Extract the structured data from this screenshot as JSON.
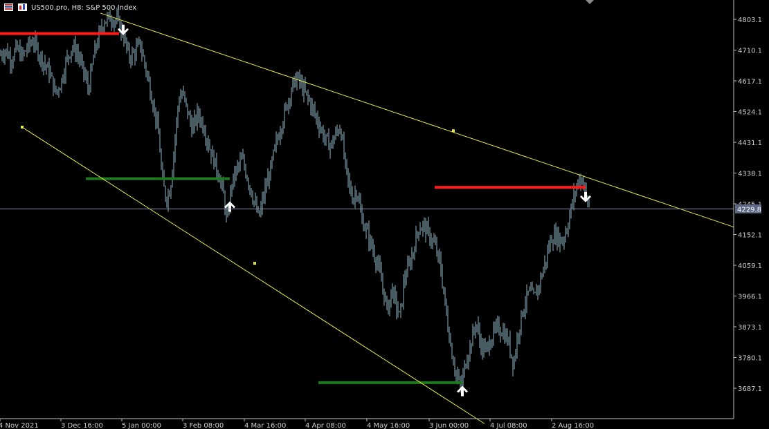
{
  "chart_data": {
    "type": "candlestick",
    "title": "US500.pro, H8:  S&P 500 Index",
    "symbol": "US500.pro",
    "timeframe": "H8",
    "description": "S&P 500 Index",
    "current_price": "4229.8",
    "y_ticks": [
      "4803.1",
      "4710.1",
      "4617.1",
      "4524.1",
      "4431.1",
      "4338.1",
      "4245.1",
      "4152.1",
      "4059.1",
      "3966.1",
      "3873.1",
      "3780.1",
      "3687.1"
    ],
    "x_ticks": [
      "4 Nov 2021",
      "3 Dec 16:00",
      "5 Jan 00:00",
      "3 Feb 08:00",
      "4 Mar 16:00",
      "4 Apr 08:00",
      "4 May 16:00",
      "3 Jun 00:00",
      "4 Jul 08:00",
      "2 Aug 16:00"
    ],
    "price_path": [
      [
        0,
        4695
      ],
      [
        8,
        4710
      ],
      [
        16,
        4680
      ],
      [
        24,
        4715
      ],
      [
        32,
        4690
      ],
      [
        40,
        4720
      ],
      [
        48,
        4740
      ],
      [
        56,
        4700
      ],
      [
        64,
        4670
      ],
      [
        72,
        4640
      ],
      [
        80,
        4580
      ],
      [
        88,
        4610
      ],
      [
        96,
        4680
      ],
      [
        104,
        4720
      ],
      [
        112,
        4700
      ],
      [
        120,
        4650
      ],
      [
        128,
        4590
      ],
      [
        136,
        4700
      ],
      [
        144,
        4760
      ],
      [
        150,
        4800
      ],
      [
        160,
        4808
      ],
      [
        170,
        4795
      ],
      [
        178,
        4760
      ],
      [
        186,
        4690
      ],
      [
        194,
        4700
      ],
      [
        202,
        4730
      ],
      [
        210,
        4660
      ],
      [
        218,
        4580
      ],
      [
        224,
        4520
      ],
      [
        230,
        4440
      ],
      [
        234,
        4320
      ],
      [
        240,
        4260
      ],
      [
        246,
        4290
      ],
      [
        252,
        4420
      ],
      [
        258,
        4560
      ],
      [
        264,
        4580
      ],
      [
        270,
        4530
      ],
      [
        278,
        4470
      ],
      [
        286,
        4520
      ],
      [
        294,
        4480
      ],
      [
        302,
        4420
      ],
      [
        310,
        4370
      ],
      [
        318,
        4320
      ],
      [
        324,
        4260
      ],
      [
        328,
        4180
      ],
      [
        334,
        4300
      ],
      [
        342,
        4350
      ],
      [
        350,
        4380
      ],
      [
        358,
        4320
      ],
      [
        366,
        4260
      ],
      [
        374,
        4200
      ],
      [
        382,
        4280
      ],
      [
        390,
        4340
      ],
      [
        398,
        4420
      ],
      [
        406,
        4480
      ],
      [
        414,
        4540
      ],
      [
        422,
        4600
      ],
      [
        430,
        4628
      ],
      [
        438,
        4590
      ],
      [
        446,
        4560
      ],
      [
        454,
        4520
      ],
      [
        462,
        4480
      ],
      [
        470,
        4440
      ],
      [
        478,
        4420
      ],
      [
        486,
        4460
      ],
      [
        492,
        4480
      ],
      [
        498,
        4370
      ],
      [
        504,
        4300
      ],
      [
        510,
        4260
      ],
      [
        516,
        4290
      ],
      [
        522,
        4200
      ],
      [
        530,
        4160
      ],
      [
        538,
        4110
      ],
      [
        546,
        4060
      ],
      [
        554,
        3980
      ],
      [
        560,
        3920
      ],
      [
        566,
        3990
      ],
      [
        572,
        3940
      ],
      [
        578,
        3900
      ],
      [
        584,
        4020
      ],
      [
        590,
        4050
      ],
      [
        598,
        4110
      ],
      [
        604,
        4170
      ],
      [
        612,
        4180
      ],
      [
        620,
        4150
      ],
      [
        628,
        4120
      ],
      [
        636,
        4060
      ],
      [
        642,
        3960
      ],
      [
        648,
        3860
      ],
      [
        654,
        3780
      ],
      [
        660,
        3720
      ],
      [
        666,
        3690
      ],
      [
        672,
        3760
      ],
      [
        680,
        3820
      ],
      [
        688,
        3890
      ],
      [
        694,
        3820
      ],
      [
        702,
        3800
      ],
      [
        710,
        3840
      ],
      [
        718,
        3870
      ],
      [
        726,
        3860
      ],
      [
        734,
        3830
      ],
      [
        742,
        3760
      ],
      [
        748,
        3850
      ],
      [
        756,
        3930
      ],
      [
        764,
        3980
      ],
      [
        772,
        3960
      ],
      [
        780,
        4010
      ],
      [
        788,
        4070
      ],
      [
        796,
        4140
      ],
      [
        804,
        4150
      ],
      [
        812,
        4130
      ],
      [
        820,
        4180
      ],
      [
        828,
        4260
      ],
      [
        836,
        4320
      ],
      [
        842,
        4320
      ],
      [
        848,
        4250
      ],
      [
        852,
        4232
      ]
    ],
    "trendlines": {
      "upper": {
        "x1": 145,
        "y1": 4822,
        "x2": 1060,
        "y2": 4175
      },
      "lower": {
        "x1": 32,
        "y1": 4477,
        "x2": 700,
        "y2": 3580
      }
    },
    "trendline_anchors": [
      {
        "x": 32,
        "price": 4477
      },
      {
        "x": 368,
        "price": 4065
      },
      {
        "x": 655,
        "price": 4466
      }
    ],
    "horizontal_levels": [
      {
        "color": "#ff1a1a",
        "price": 4760,
        "x1": 0,
        "x2": 172
      },
      {
        "color": "#1e7a1e",
        "price": 4321,
        "x1": 124,
        "x2": 332
      },
      {
        "color": "#ff1a1a",
        "price": 4295,
        "x1": 628,
        "x2": 846
      },
      {
        "color": "#1e7a1e",
        "price": 3704,
        "x1": 460,
        "x2": 668
      }
    ],
    "arrows": [
      {
        "direction": "down",
        "x": 178,
        "price": 4768
      },
      {
        "direction": "up",
        "x": 332,
        "price": 4240
      },
      {
        "direction": "down",
        "x": 846,
        "price": 4262
      },
      {
        "direction": "up",
        "x": 668,
        "price": 3682
      }
    ],
    "colors": {
      "background": "#000000",
      "candles": "#8fb6c4",
      "trendline": "#e8e84a",
      "price_line": "#8a94a8",
      "price_tag_bg": "#5d6a85",
      "axis": "#c0c0c0"
    }
  }
}
